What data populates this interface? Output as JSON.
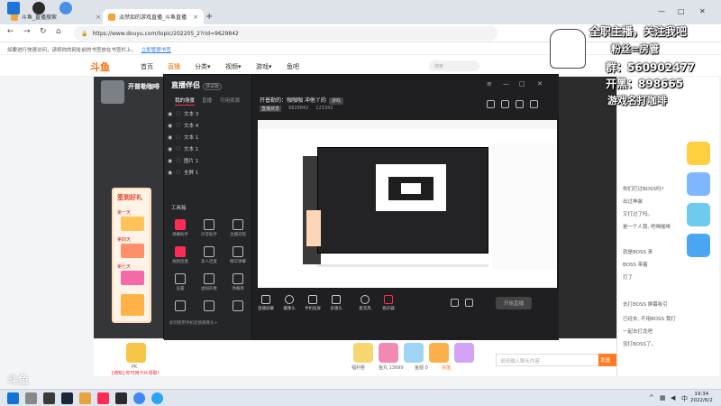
{
  "browser": {
    "tabs": [
      {
        "title": "斗鱼_直播搜索",
        "active": false
      },
      {
        "title": "淡然如的游戏直播_斗鱼直播",
        "active": true
      }
    ],
    "new_tab": "+",
    "url": "https://www.douyu.com/topic/202205_2?rid=9629842",
    "infobar_text": "如要进行快速访问，请将你的网址前的书签放在书签栏上。",
    "infobar_link": "立即管理书签",
    "window_controls": [
      "—",
      "□",
      "✕"
    ]
  },
  "douyu": {
    "logo": "斗鱼",
    "nav": [
      "首页",
      "直播",
      "分类▾",
      "视频▾",
      "游戏▾",
      "鱼吧"
    ],
    "search_placeholder": "搜索",
    "anchor_name": "开普勒咖啡",
    "chat_lines": [
      "你们打过BOSS吗?",
      "出过神装",
      "又打过了吗。",
      "是一个人我, 吧喝咖啡",
      "就是BOSS 来",
      "BOSS 带着",
      "打了",
      "去打BOSS 屏幕吸引",
      "已经去, 不用BOSS 我打",
      "一起去打龙吧",
      "没打BOSS了。"
    ],
    "chat_input_placeholder": "说说输入聊天内容",
    "send_label": "发送",
    "gift_labels": [
      "PK",
      "福利卷",
      "鱼丸 13699",
      "鱼翅 0",
      "充值"
    ],
    "room_tag": "[通知] 你可用卡片领取!"
  },
  "companion": {
    "app_name": "直播伴侣",
    "badge": "测试版",
    "tabs": [
      "我的场景",
      "直播",
      "可用资源"
    ],
    "sources": [
      {
        "name": "文本 3"
      },
      {
        "name": "文本 4"
      },
      {
        "name": "文本 1"
      },
      {
        "name": "文本 1"
      },
      {
        "name": "图片 1"
      },
      {
        "name": "全屏 1"
      }
    ],
    "tools_label": "工具箱",
    "tools": [
      "弹幕助手",
      "声音助手",
      "主播日程",
      "视频连麦",
      "多人连麦",
      "精华弹幕",
      "设置",
      "虚拟形象",
      "弹幕库",
      "",
      "",
      ""
    ],
    "tip": "如何使用手机连接摄像头>",
    "stream_title": "开普勒的：咖咖咖 冲他丫的",
    "stream_tag": "游戏",
    "live_status": "直播状态",
    "room_id": "9629842",
    "viewers": "123342",
    "controls": [
      "直播屏幕",
      "摄像头",
      "手机投屏",
      "多镜头",
      "麦克风",
      "扬声器"
    ],
    "start_button": "开始直播"
  },
  "overlay": {
    "line1": "全职主播，关注我吧",
    "line2": "粉丝=房管",
    "line3": "群：560902477",
    "line4": "开黑：898665",
    "line5": "游戏名打咖啡"
  },
  "taskbar": {
    "time": "19:34",
    "date": "2022/6/2"
  },
  "bottom_logo": "斗鱼"
}
